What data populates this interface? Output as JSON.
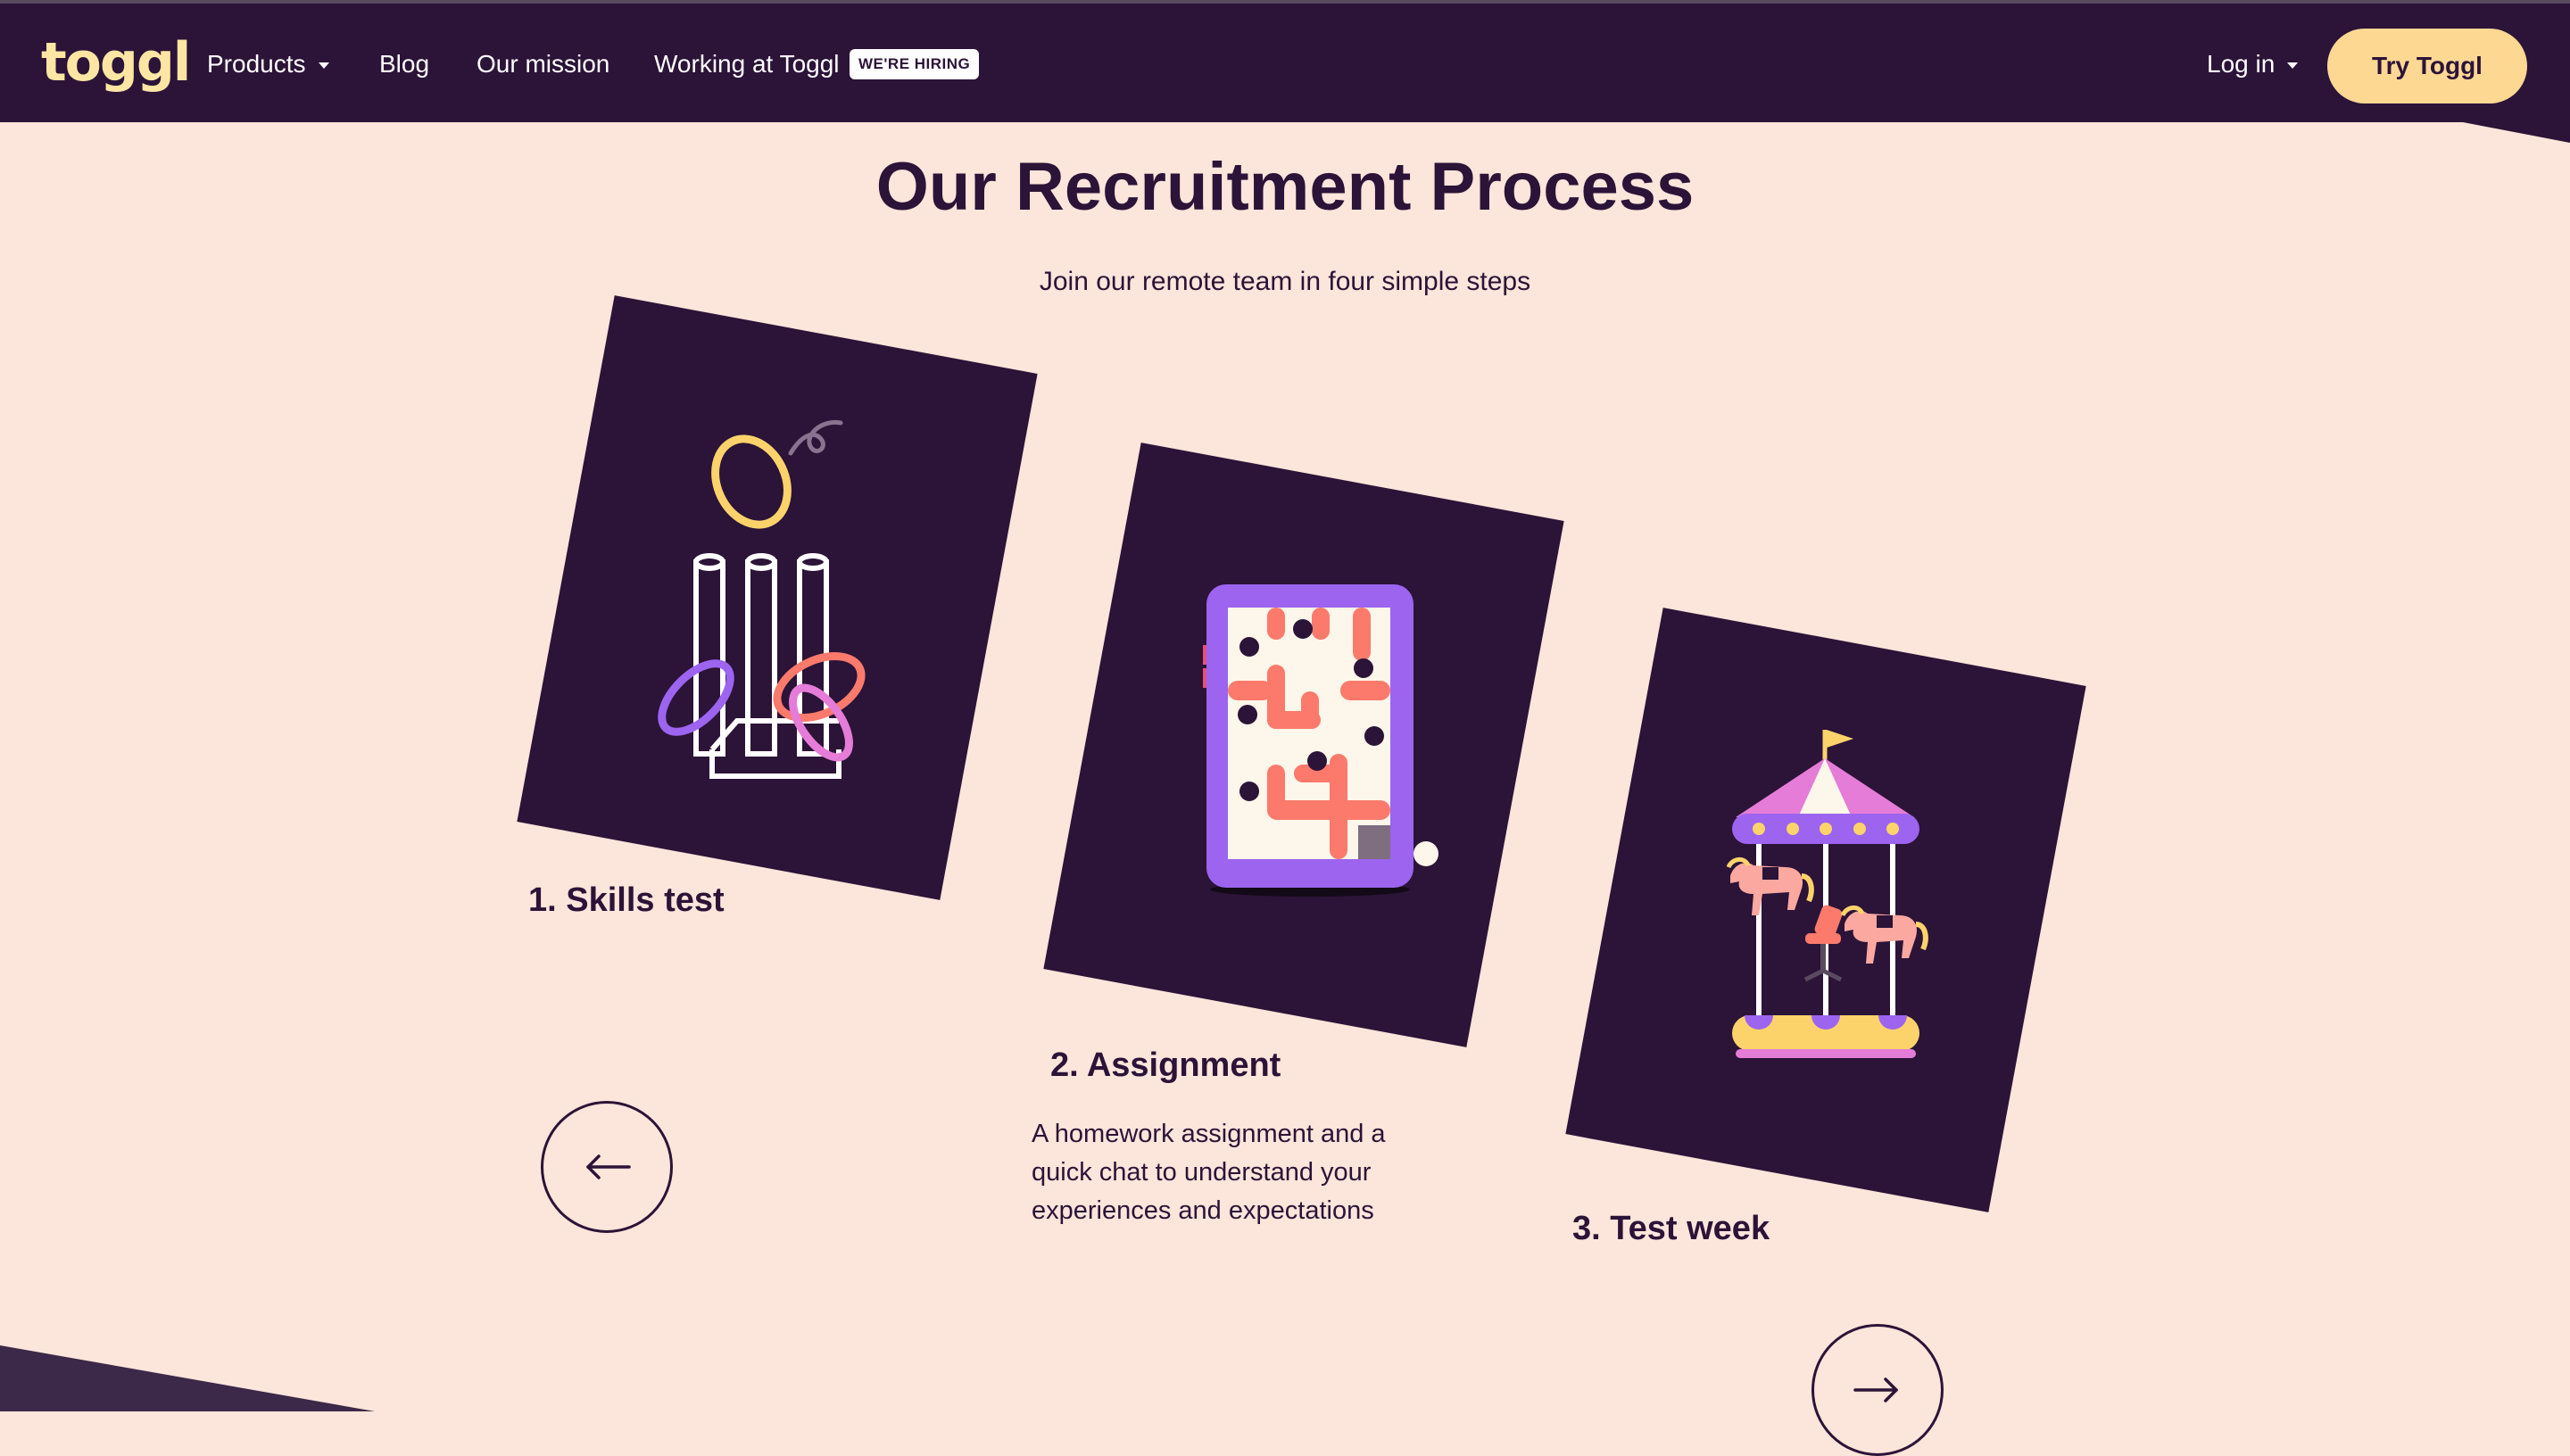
{
  "nav": {
    "logo": "toggl",
    "items": [
      {
        "label": "Products"
      },
      {
        "label": "Blog"
      },
      {
        "label": "Our mission"
      },
      {
        "label": "Working at Toggl"
      }
    ],
    "hiring_badge": "WE'RE HIRING",
    "login_label": "Log in",
    "cta_label": "Try Toggl"
  },
  "section": {
    "title": "Our Recruitment Process",
    "subtitle": "Join our remote team in four simple steps"
  },
  "steps": [
    {
      "title": "1. Skills test",
      "icon": "ring-toss-icon"
    },
    {
      "title": "2. Assignment",
      "icon": "maze-tablet-icon",
      "description": "A homework assignment and a quick chat to understand your experiences and expectations"
    },
    {
      "title": "3. Test week",
      "icon": "carousel-icon"
    }
  ],
  "carousel_controls": {
    "prev_icon": "arrow-left-icon",
    "next_icon": "arrow-right-icon"
  },
  "colors": {
    "navy": "#2c1338",
    "background": "#fce5da",
    "cta_yellow": "#fcd893",
    "logo_yellow": "#fde6a4",
    "purple": "#9c64ef",
    "coral": "#fb7a6b",
    "pink": "#e57cd8"
  }
}
